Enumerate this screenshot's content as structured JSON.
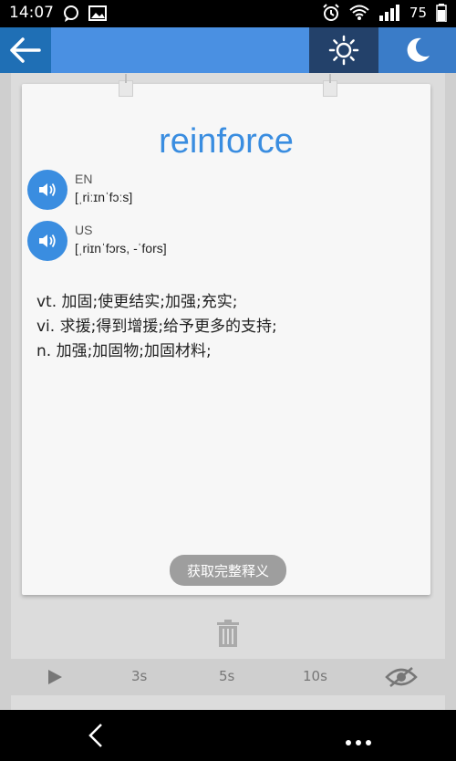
{
  "status": {
    "time": "14:07",
    "battery": "75"
  },
  "word": {
    "title": "reinforce",
    "pronunciations": [
      {
        "label": "EN",
        "ipa": "[ˌriːɪnˈfɔːs]"
      },
      {
        "label": "US",
        "ipa": "[ˌriɪnˈfɔrs, -ˈfors]"
      }
    ],
    "definitions": [
      "vt. 加固;使更结实;加强;充实;",
      "vi. 求援;得到增援;给予更多的支持;",
      "n. 加强;加固物;加固材料;"
    ],
    "full_definition_label": "获取完整释义"
  },
  "playback": {
    "intervals": [
      "3s",
      "5s",
      "10s"
    ]
  },
  "icons": {
    "back": "arrow-left-icon",
    "day": "sun-icon",
    "night": "moon-icon",
    "speaker": "speaker-icon",
    "trash": "trash-icon",
    "play": "play-icon",
    "eye": "eye-slash-icon"
  },
  "colors": {
    "accent": "#4a90e2",
    "active_mode": "#23416a",
    "word": "#3a8de0"
  }
}
